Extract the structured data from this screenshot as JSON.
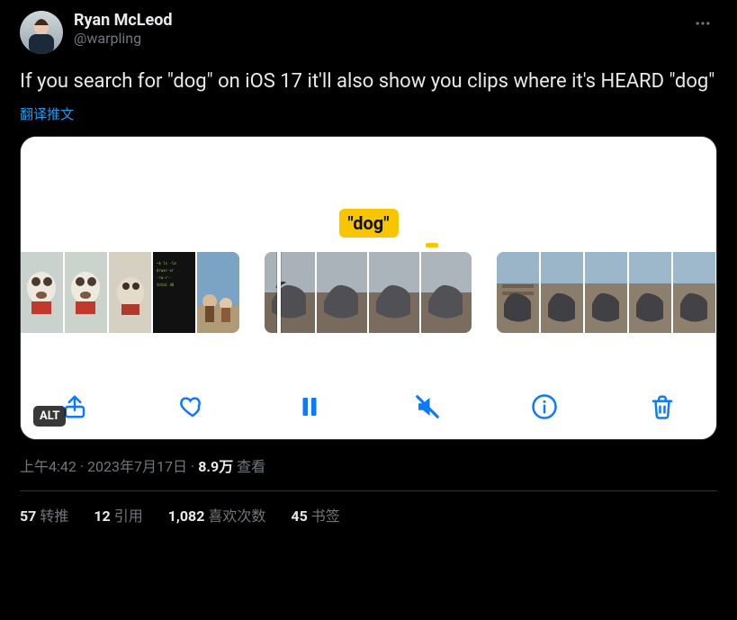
{
  "author": {
    "display_name": "Ryan McLeod",
    "handle": "@warpling"
  },
  "body": "If you search for \"dog\" on iOS 17 it'll also show you clips where it's HEARD \"dog\"",
  "translate_label": "翻译推文",
  "media": {
    "caption_chip": "\"dog\"",
    "alt_badge": "ALT",
    "controls": {
      "share": "share-icon",
      "like": "heart-icon",
      "pause": "pause-icon",
      "mute": "speaker-muted-icon",
      "info": "info-icon",
      "trash": "trash-icon"
    }
  },
  "meta": {
    "time": "上午4:42",
    "date": "2023年7月17日",
    "views_count": "8.9万",
    "views_label": "查看"
  },
  "stats": {
    "retweets_n": "57",
    "retweets_label": "转推",
    "quotes_n": "12",
    "quotes_label": "引用",
    "likes_n": "1,082",
    "likes_label": "喜欢次数",
    "bookmarks_n": "45",
    "bookmarks_label": "书签"
  }
}
